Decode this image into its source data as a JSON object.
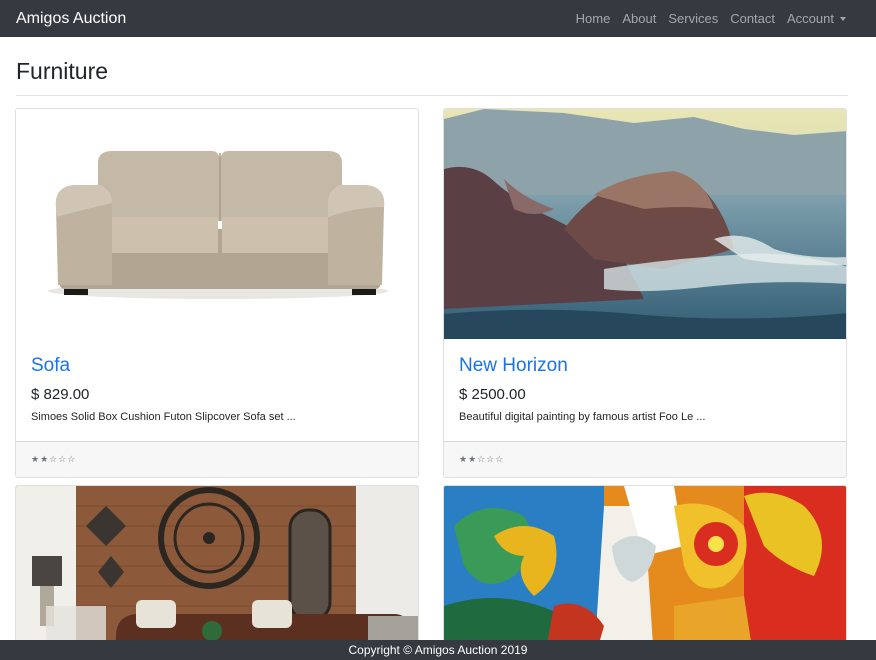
{
  "navbar": {
    "brand": "Amigos Auction",
    "links": [
      "Home",
      "About",
      "Services",
      "Contact",
      "Account"
    ]
  },
  "page": {
    "title": "Furniture"
  },
  "cards": [
    {
      "title": "Sofa",
      "price": "$ 829.00",
      "description": "Simoes Solid Box Cushion Futon Slipcover Sofa set ...",
      "rating": "★★☆☆☆"
    },
    {
      "title": "New Horizon",
      "price": "$ 2500.00",
      "description": "Beautiful digital painting by famous artist Foo Le ...",
      "rating": "★★☆☆☆"
    }
  ],
  "footer": {
    "text": "Copyright © Amigos Auction 2019"
  }
}
